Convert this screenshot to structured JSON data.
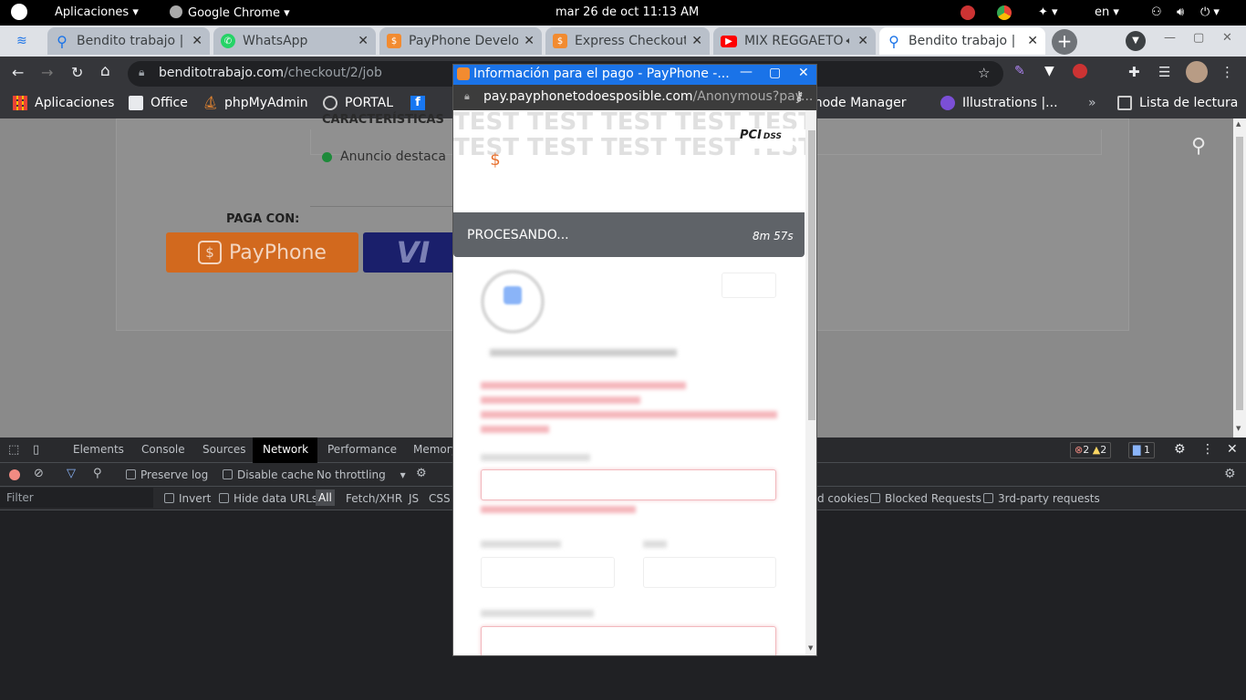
{
  "system_bar": {
    "apps_menu": "Aplicaciones",
    "active_app": "Google Chrome",
    "datetime": "mar 26 de oct  11:13 AM",
    "language": "en"
  },
  "tabs": [
    {
      "title": "Bendito trabajo |",
      "color": "#1a73e8"
    },
    {
      "title": "WhatsApp",
      "color": "#25d366"
    },
    {
      "title": "PayPhone Develo",
      "color": "#f28b30"
    },
    {
      "title": "Express Checkout",
      "color": "#f28b30"
    },
    {
      "title": "MIX REGGAETO",
      "color": "#ff0000"
    },
    {
      "title": "Bendito trabajo |",
      "color": "#1a73e8"
    }
  ],
  "address_bar": {
    "domain": "benditotrabajo.com",
    "path": "/checkout/2/job"
  },
  "bookmarks": [
    {
      "label": "Aplicaciones"
    },
    {
      "label": "Office"
    },
    {
      "label": "phpMyAdmin"
    },
    {
      "label": "PORTAL"
    },
    {
      "label": "Linode Manager"
    },
    {
      "label": "Illustrations |..."
    },
    {
      "label": "Lista de lectura"
    }
  ],
  "page": {
    "feature_heading": "CARACTERÍSTICAS",
    "feature_item": "Anuncio destaca",
    "pay_with": "PAGA CON:",
    "payphone_button": "PayPhone",
    "visa_button": "VI"
  },
  "popup": {
    "title": "Información para el pago - PayPhone -...",
    "url_domain": "pay.payphonetodoesposible.com",
    "url_path": "/Anonymous?pay...",
    "test_text": "TEST TEST TEST TEST TEST",
    "pci_label": "PCI",
    "dss_label": "DSS",
    "processing": "PROCESANDO...",
    "timer": "8m 57s"
  },
  "devtools": {
    "tabs": [
      "Elements",
      "Console",
      "Sources",
      "Network",
      "Performance",
      "Memory"
    ],
    "active_tab": "Network",
    "errors": "2",
    "warnings": "2",
    "messages": "1",
    "preserve_log": "Preserve log",
    "disable_cache": "Disable cache",
    "throttling": "No throttling",
    "filter_placeholder": "Filter",
    "invert": "Invert",
    "hide_data_urls": "Hide data URLs",
    "type_filters": [
      "All",
      "Fetch/XHR",
      "JS",
      "CSS"
    ],
    "cookies_suffix": "d cookies",
    "blocked_requests": "Blocked Requests",
    "third_party": "3rd-party requests"
  }
}
